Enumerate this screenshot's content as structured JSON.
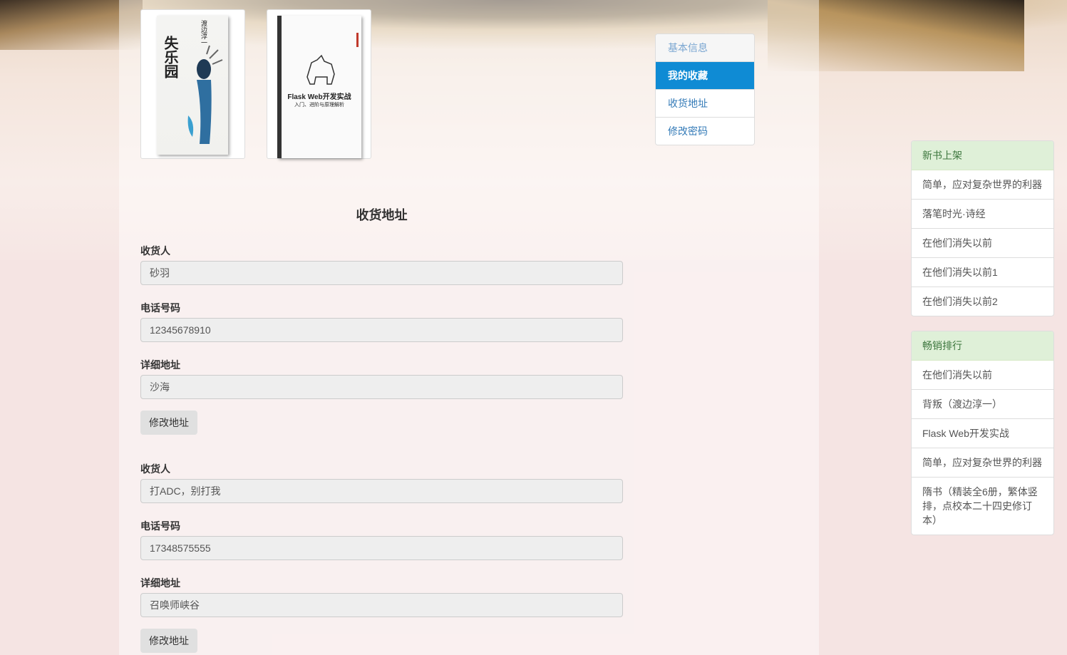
{
  "books": [
    {
      "cover_title": "失乐园",
      "cover_author": "渡边淳一"
    },
    {
      "cover_title": "Flask Web开发实战",
      "cover_subtitle": "入门、进阶与原理解析"
    }
  ],
  "menu": {
    "items": [
      {
        "label": "基本信息"
      },
      {
        "label": "我的收藏"
      },
      {
        "label": "收货地址"
      },
      {
        "label": "修改密码"
      }
    ]
  },
  "page_title": "收货地址",
  "addresses": [
    {
      "name_label": "收货人",
      "name_value": "砂羽",
      "phone_label": "电话号码",
      "phone_value": "12345678910",
      "address_label": "详细地址",
      "address_value": "沙海",
      "button_label": "修改地址"
    },
    {
      "name_label": "收货人",
      "name_value": "打ADC，别打我",
      "phone_label": "电话号码",
      "phone_value": "17348575555",
      "address_label": "详细地址",
      "address_value": "召唤师峡谷",
      "button_label": "修改地址"
    }
  ],
  "new_books": {
    "heading": "新书上架",
    "items": [
      "简单，应对复杂世界的利器",
      "落笔时光·诗经",
      "在他们消失以前",
      "在他们消失以前1",
      "在他们消失以前2"
    ]
  },
  "bestsellers": {
    "heading": "畅销排行",
    "items": [
      "在他们消失以前",
      "背叛（渡边淳一）",
      "Flask Web开发实战",
      "简单，应对复杂世界的利器",
      "隋书（精装全6册，繁体竖排，点校本二十四史修订本）"
    ]
  }
}
